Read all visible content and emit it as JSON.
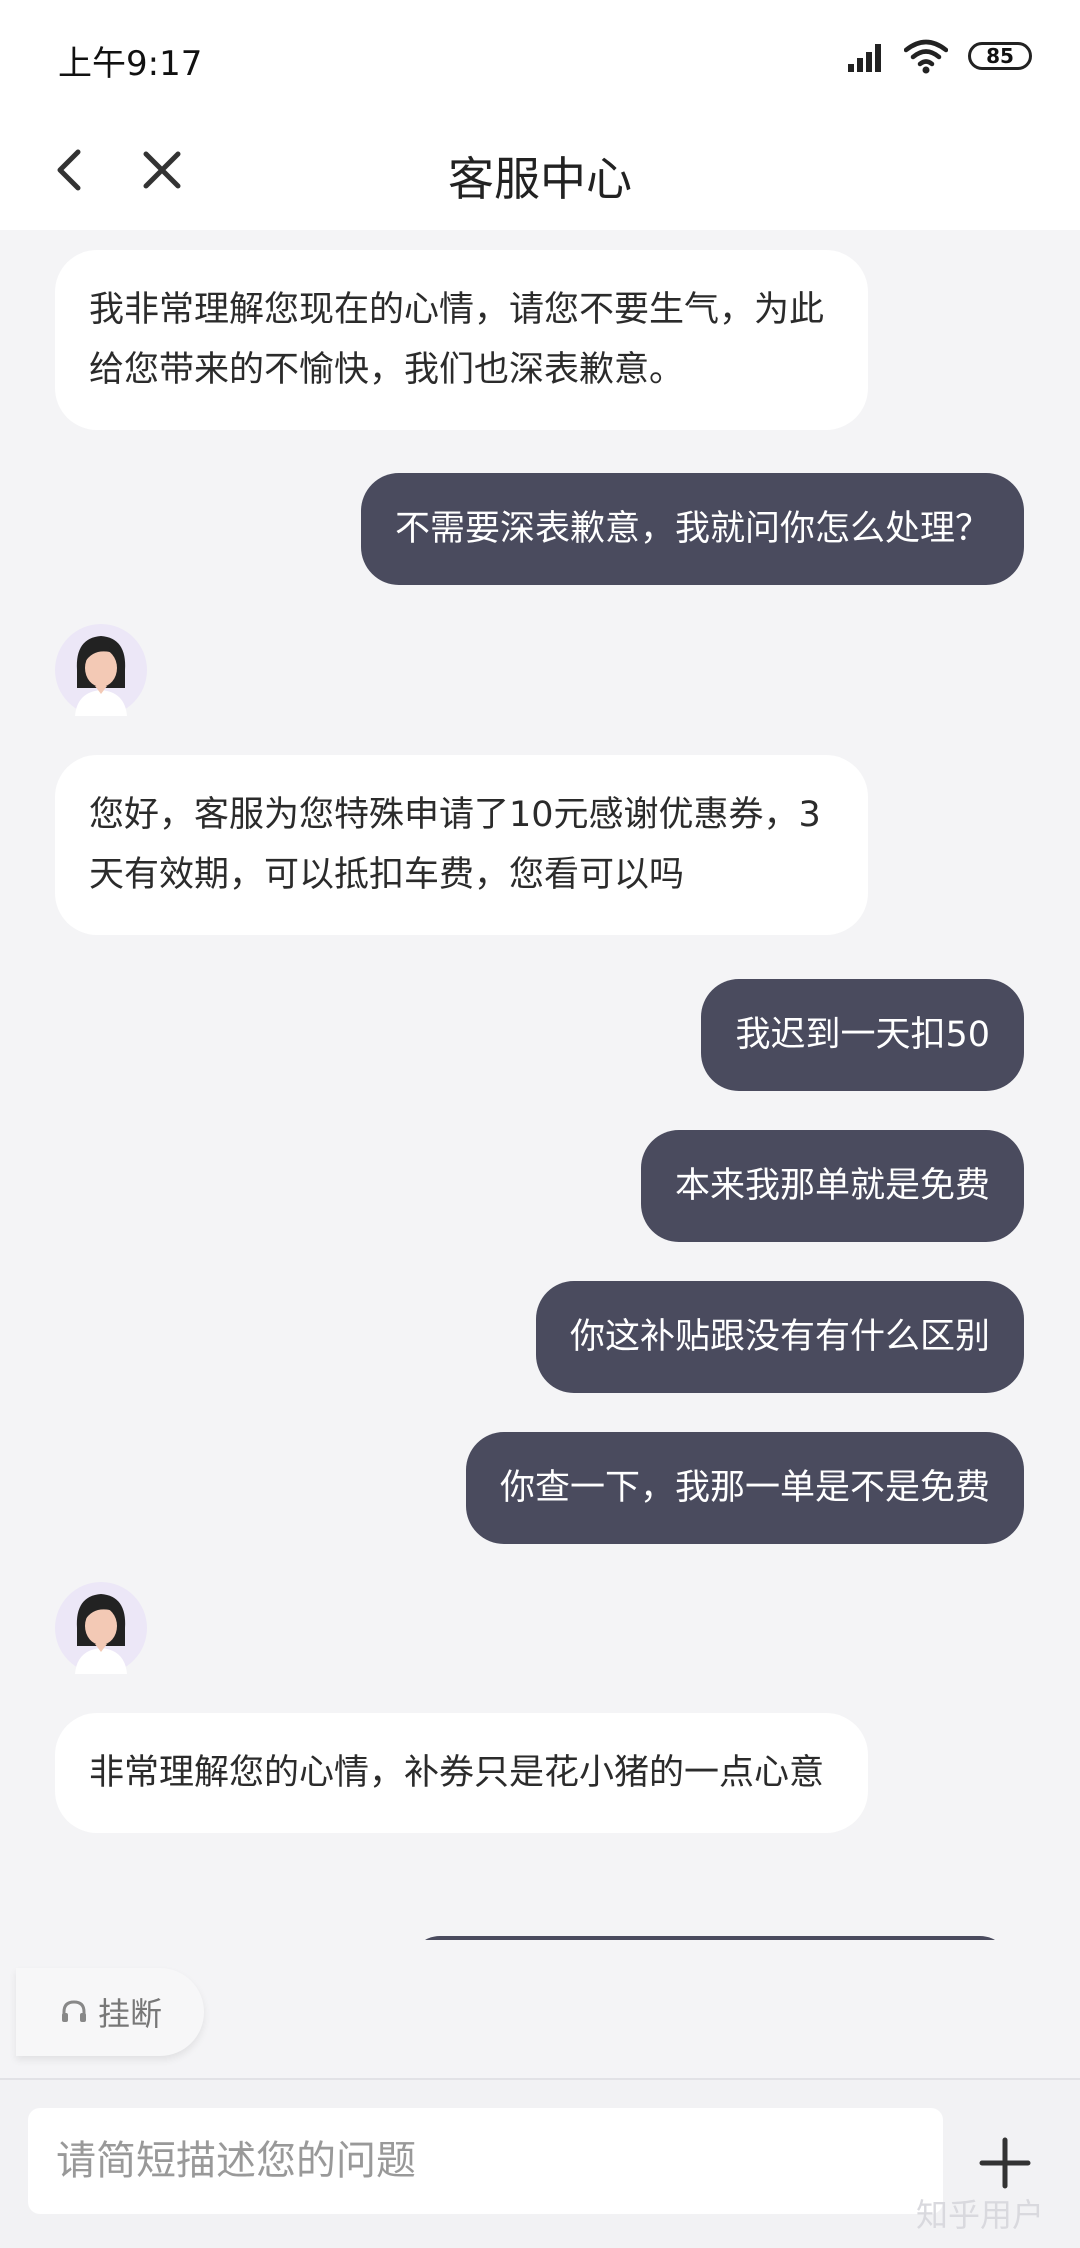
{
  "status_bar": {
    "time": "上午9:17",
    "battery": "85",
    "icons": [
      "signal-icon",
      "wifi-icon",
      "battery-icon"
    ]
  },
  "header": {
    "title": "客服中心",
    "icons": [
      "back-arrow-icon",
      "close-icon"
    ]
  },
  "messages": [
    {
      "from": "agent",
      "text": "我非常理解您现在的心情，请您不要生气，为此给您带来的不愉快，我们也深表歉意。"
    },
    {
      "from": "user",
      "text": "不需要深表歉意，我就问你怎么处理？"
    },
    {
      "from": "agent",
      "text": "您好，客服为您特殊申请了10元感谢优惠券，3天有效期，可以抵扣车费，您看可以吗"
    },
    {
      "from": "user",
      "text": "我迟到一天扣50"
    },
    {
      "from": "user",
      "text": "本来我那单就是免费"
    },
    {
      "from": "user",
      "text": "你这补贴跟没有有什么区别"
    },
    {
      "from": "user",
      "text": "你查一下，我那一单是不是免费"
    },
    {
      "from": "agent",
      "text": "非常理解您的心情，补券只是花小猪的一点心意"
    }
  ],
  "hangup": {
    "label": "挂断",
    "icon": "headset-icon"
  },
  "composer": {
    "placeholder": "请简短描述您的问题",
    "value": "",
    "plus_icon": "plus-icon"
  },
  "watermark": "知乎用户",
  "colors": {
    "user_bubble": "#4a4b5e",
    "agent_bubble": "#ffffff",
    "background": "#f4f4f6"
  }
}
